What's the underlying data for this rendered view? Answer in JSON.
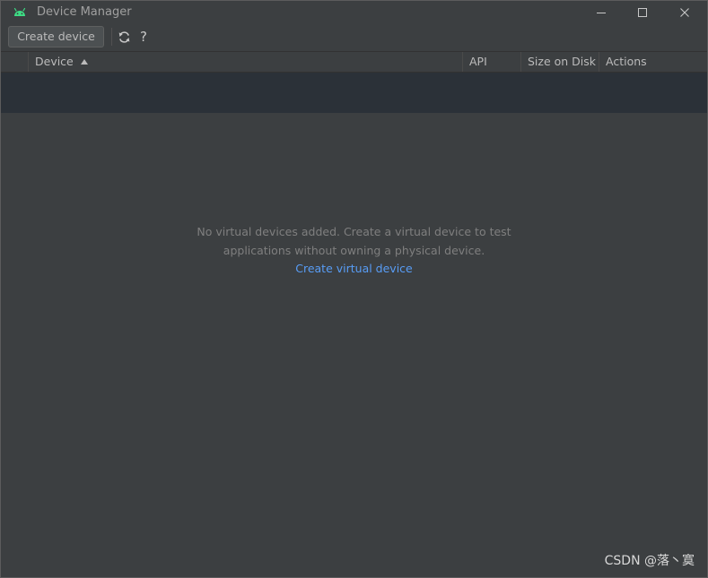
{
  "window": {
    "title": "Device Manager",
    "colors": {
      "background": "#3c3f41",
      "link": "#589df6",
      "android_icon": "#3ddc84",
      "band": "#2b3138"
    }
  },
  "toolbar": {
    "create_device_label": "Create device",
    "refresh_icon": "refresh-icon",
    "help_label": "?"
  },
  "table": {
    "columns": [
      "",
      "Device",
      "API",
      "Size on Disk",
      "Actions"
    ],
    "sort_column": "Device",
    "sort_direction": "ascending",
    "rows": []
  },
  "empty_state": {
    "line1": "No virtual devices added. Create a virtual device to test",
    "line2": "applications without owning a physical device.",
    "link": "Create virtual device"
  },
  "watermark": "CSDN @落丶寞"
}
